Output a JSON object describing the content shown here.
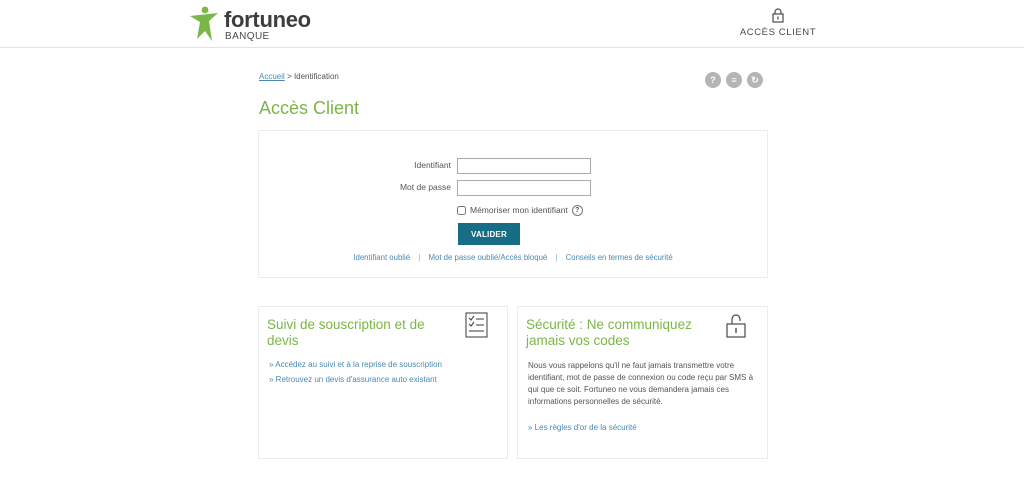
{
  "header": {
    "brand_name": "fortuneo",
    "brand_sub": "BANQUE",
    "access_label": "ACCÈS CLIENT",
    "brand_color": "#7ab648"
  },
  "breadcrumb": {
    "home": "Accueil",
    "separator": ">",
    "current": "Identification"
  },
  "tools": {
    "help": "?",
    "print": "≡",
    "refresh": "↻"
  },
  "page": {
    "title": "Accès Client"
  },
  "login": {
    "identifiant_label": "Identifiant",
    "identifiant_value": "",
    "password_label": "Mot de passe",
    "password_value": "",
    "remember_label": "Mémoriser mon identifiant",
    "remember_checked": false,
    "help_badge": "?",
    "submit_label": "VALIDER",
    "submit_color": "#176d86",
    "links": {
      "forgot_id": "Identifiant oublié",
      "forgot_pw": "Mot de passe oublié/Accès bloqué",
      "security": "Conseils en termes de sécurité",
      "separator": "|"
    }
  },
  "cards": {
    "subscription": {
      "title": "Suivi de souscription et de devis",
      "link_1": "» Accédez au suivi et à la reprise de souscription",
      "link_2": "» Retrouvez un devis d'assurance auto existant",
      "icon": "checklist-icon"
    },
    "security": {
      "title": "Sécurité : Ne communiquez jamais vos codes",
      "body": "Nous vous rappelons qu'il ne faut jamais transmettre votre identifiant, mot de passe de connexion ou code reçu par SMS à qui que ce soit. Fortuneo ne vous demandera jamais ces informations personnelles de sécurité.",
      "link": "» Les règles d'or de la sécurité",
      "icon": "open-lock-icon"
    }
  }
}
